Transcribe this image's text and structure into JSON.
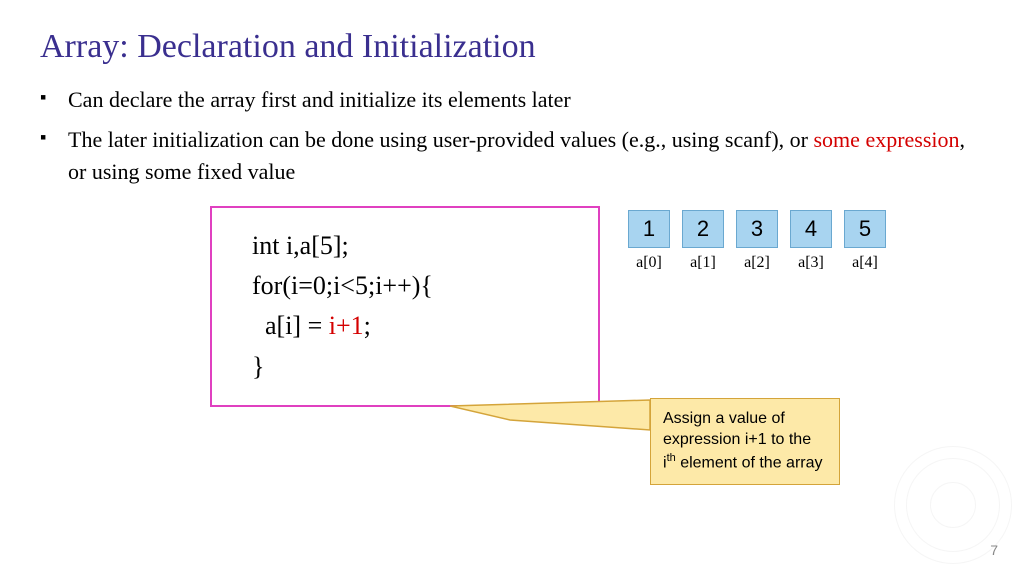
{
  "title": "Array: Declaration and Initialization",
  "bullets": [
    {
      "text": "Can declare the array first and initialize its elements later"
    },
    {
      "pre": "The later initialization can be done using user-provided values (e.g., using scanf), or ",
      "em": "some expression",
      "post": ", or using some fixed value"
    }
  ],
  "code": {
    "l1": "int i,a[5];",
    "l2": "for(i=0;i<5;i++){",
    "l3a": "  a[i] = ",
    "l3b": "i+1",
    "l3c": ";",
    "l4": "}"
  },
  "array": {
    "values": [
      "1",
      "2",
      "3",
      "4",
      "5"
    ],
    "labels": [
      "a[0]",
      "a[1]",
      "a[2]",
      "a[3]",
      "a[4]"
    ]
  },
  "callout": {
    "t1": "Assign a value of expression i+1 to the i",
    "sup": "th",
    "t2": " element of the array"
  },
  "page": "7"
}
